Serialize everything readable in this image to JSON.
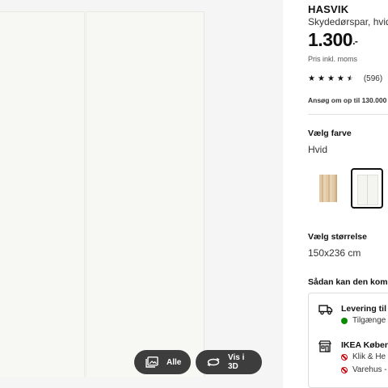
{
  "gallery": {
    "all_button": "Alle",
    "view3d_button": "Vis i 3D"
  },
  "product": {
    "name": "HASVIK",
    "subtitle": "Skydedørspar, hvid",
    "price_main": "1.300",
    "price_suffix": ".-",
    "price_note": "Pris inkl. moms",
    "rating_stars": 4.5,
    "rating_count": "(596)",
    "finance_link": "Ansøg om op til 130.000"
  },
  "colour": {
    "label": "Vælg farve",
    "value": "Hvid",
    "options": [
      "oak-effect",
      "white"
    ],
    "selected": "white"
  },
  "size": {
    "label": "Vælg størrelse",
    "value": "150x236 cm"
  },
  "availability": {
    "heading": "Sådan kan den kom",
    "delivery_title": "Levering til",
    "delivery_status": "Tilgænge",
    "store_title": "IKEA Køben",
    "click_collect": "Klik & He",
    "warehouse": "Varehus -"
  },
  "colors": {
    "available_green": "#0a8a00",
    "unavailable_red": "#cc0008",
    "pill_bg": "#3d3d3d"
  }
}
